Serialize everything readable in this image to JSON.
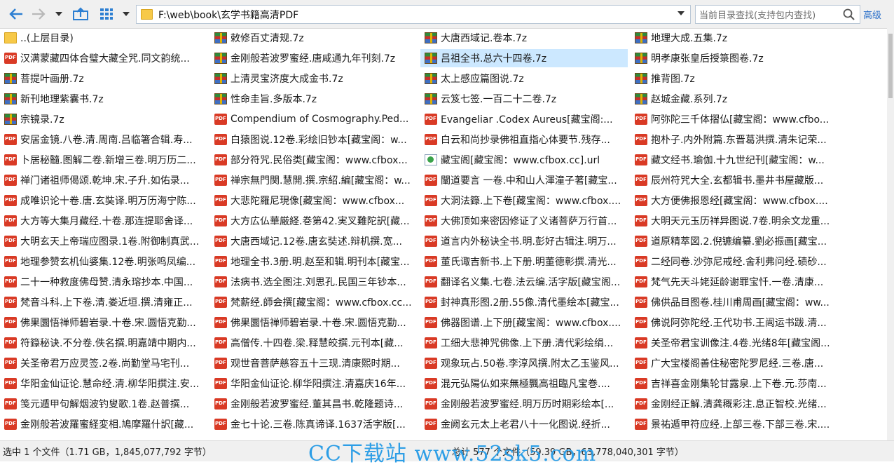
{
  "toolbar": {
    "address": "F:\\web\\book\\玄学书籍高清PDF",
    "search_placeholder": "当前目录查找(支持包内查找)",
    "advanced": "高级"
  },
  "files": [
    [
      "..(上层目录)",
      "敕修百丈清规.7z",
      "大唐西域记.卷本.7z",
      "地理大成.五集.7z"
    ],
    [
      "汉满蒙藏四体合璧大藏全咒.同文韵统...",
      "金刚般若波罗蜜经.唐咸通九年刊刻.7z",
      "吕祖全书.总六十四卷.7z",
      "明孝康张皇后授箓图卷.7z"
    ],
    [
      "菩提叶画册.7z",
      "上清灵宝济度大成金书.7z",
      "太上感应篇图说.7z",
      "推背图.7z"
    ],
    [
      "新刊地理紫囊书.7z",
      "性命圭旨.多版本.7z",
      "云笈七签.一百二十二卷.7z",
      "赵城金藏.系列.7z"
    ],
    [
      "宗镜录.7z",
      "Compendium of Cosmography.Ped...",
      "Evangeliar .Codex Aureus[藏宝阁:...",
      "阿弥陀三千体摺仏[藏宝阁：www.cfbo..."
    ],
    [
      "安居金镜.八卷.清.周南.吕临箸合辑.寿...",
      "白猿图说.12卷.彩绘旧钞本[藏宝阁：w...",
      "白云和尚抄录佛祖直指心体要节.残存...",
      "抱朴子.内外附篇.东晋葛洪撰.清朱记荣..."
    ],
    [
      "卜居秘髓.图解二卷.新增三卷.明万历二...",
      "部分符咒.民俗类[藏宝阁：www.cfbox...",
      "藏宝阁[藏宝阁：www.cfbox.cc].url",
      "藏文经书.瑜伽.十九世纪刊[藏宝阁：w..."
    ],
    [
      "禅门诸祖师偈颂.乾坤.宋.子升.如佑录...",
      "禅宗無門関.慧開.撰.宗紹.編[藏宝阁：w...",
      "闡道要言 一卷.中和山人渾潼子著[藏宝...",
      "辰州符咒大全.玄都辑书.墨井书屋藏版..."
    ],
    [
      "成唯识论十卷.唐.玄奘译.明万历海宁陈...",
      "大悲陀羅尼現像[藏宝阁：www.cfbox...",
      "大洞法籙.上下卷[藏宝阁：www.cfbox....",
      "大方便佛报恩经[藏宝阁：www.cfbox...."
    ],
    [
      "大方等大集月藏经.十卷.那连提耶舍译...",
      "大方広仏華厳経.巻第42.実叉難陀訳[藏...",
      "大佛顶如来密因修证了义诸菩萨万行首...",
      "大明天元玉历祥异图说.7卷.明余文龙重..."
    ],
    [
      "大明玄天上帝瑞应图录.1卷.附御制真武...",
      "大唐西域记.12卷.唐玄奘述.辩机撰.宽...",
      "道言内外秘诀全书.明.彭好古辑注.明万...",
      "道原精萃図.2.倪镳编纂.劉必振画[藏宝..."
    ],
    [
      "地理参赞玄机仙婆集.12卷.明张鸣凤编...",
      "地理全书.3册.明.赵至和辑.明刊本[藏宝...",
      "董氏诹吉新书.上下册.明董德彰撰.清光...",
      "二经同卷.沙弥尼戒经.舍利弗问经.碛砂..."
    ],
    [
      "二十一种救度佛母赞.清永瑢抄本.中国...",
      "法病书.选全图注.刘思孔.民国三年钞本...",
      "翻译名义集.七卷.法云编.活字版[藏宝阁...",
      "梵气先天斗姥延龄谢罪宝忏.一卷.清康..."
    ],
    [
      "梵音斗科.上下卷.清.娄近垣.撰.清雍正...",
      "梵薪经.師会撰[藏宝阁：www.cfbox.cc...",
      "封神真形图.2册.55像.清代墨绘本[藏宝...",
      "佛供品目图卷.桂川甫周画[藏宝阁：ww..."
    ],
    [
      "佛果圜悟禅师碧岩录.十卷.宋.圆悟克勤...",
      "佛果圜悟禅师碧岩录.十卷.宋.圆悟克勤...",
      "佛器图谱.上下册[藏宝阁：www.cfbox....",
      "佛说阿弥陀经.王代功书.王闿运书跋.清..."
    ],
    [
      "符籙秘诀.不分卷.佚名撰.明嘉靖中期内...",
      "高僧传.十四卷.梁.释慧皎撰.元刊本[藏...",
      "工细大悲神咒佛像.上下册.清代彩绘绢...",
      "关圣帝君宝训像注.4卷.光绪8年[藏宝阁..."
    ],
    [
      "关圣帝君万应灵签.2卷.尚勤堂马宅刊...",
      "观世音菩萨慈容五十三现.清康熙时期...",
      "观象玩占.50卷.李淳风撰.附太乙玉鉴风...",
      "广大宝楼阁善住秘密陀罗尼经.三卷.唐..."
    ],
    [
      "华阳金仙证论.慧命经.清.柳华阳撰注.安...",
      "华阳金仙证论.柳华阳撰注.清嘉庆16年...",
      "混元弘陽仏如来無極飄高祖臨凡宝巻....",
      "吉祥喜金刚集轮甘露泉.上下卷.元.莎南..."
    ],
    [
      "笺元遁甲句解烟波钓叟歌.1卷.赵普撰...",
      "金刚般若波罗蜜经.董其昌书.乾隆题诗...",
      "金刚般若波罗蜜经.明万历时期彩绘本[...",
      "金刚经正解.清龚穊彩注.息正智校.光绪..."
    ],
    [
      "金刚般若波羅蜜経変相.鳩摩羅什訳[藏...",
      "金七十论.三卷.陈真谛译.1637活字版[...",
      "金阙玄元太上老君八十一化图说.经折...",
      "景祐遁甲符应经.上部三卷.下部三卷.宋...."
    ]
  ],
  "status": {
    "selected": "选中 1 个文件（1.71 GB，1,845,077,792 字节）",
    "total": "总计 577 个文件（59.39 GB，63,778,040,301 字节）"
  },
  "watermark": "CC下载站  www.52sk5.com"
}
